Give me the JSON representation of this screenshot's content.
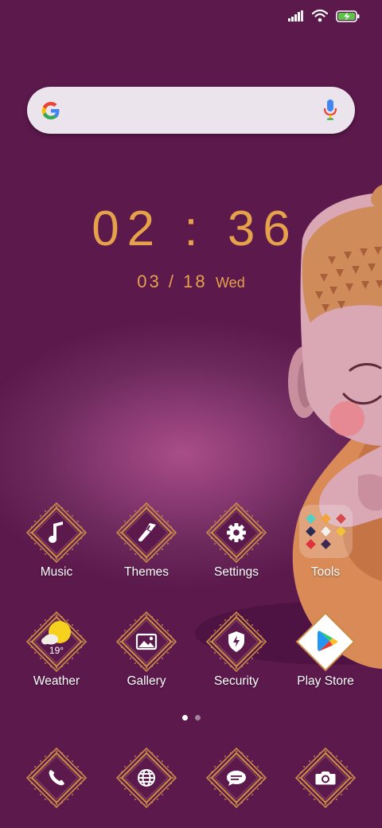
{
  "status_bar": {
    "signal_icon": "signal-bars-icon",
    "wifi_icon": "wifi-icon",
    "battery_icon": "battery-charging-icon"
  },
  "search": {
    "logo_icon": "google-logo-icon",
    "mic_icon": "mic-icon"
  },
  "clock": {
    "time": "02 : 36",
    "date": "03 / 18",
    "weekday": "Wed"
  },
  "home_apps": [
    {
      "label": "Music",
      "icon": "music-note-icon"
    },
    {
      "label": "Themes",
      "icon": "paintbrush-icon"
    },
    {
      "label": "Settings",
      "icon": "gear-icon"
    },
    {
      "label": "Tools",
      "icon": "folder-icon"
    },
    {
      "label": "Weather",
      "icon": "weather-icon",
      "temperature": "19°"
    },
    {
      "label": "Gallery",
      "icon": "image-icon"
    },
    {
      "label": "Security",
      "icon": "shield-icon"
    },
    {
      "label": "Play Store",
      "icon": "play-store-icon"
    }
  ],
  "dock": [
    {
      "name": "phone",
      "icon": "phone-icon"
    },
    {
      "name": "browser",
      "icon": "globe-icon"
    },
    {
      "name": "messages",
      "icon": "message-icon"
    },
    {
      "name": "camera",
      "icon": "camera-icon"
    }
  ],
  "page_indicator": {
    "pages": 2,
    "current": 1
  },
  "colors": {
    "background": "#5c194c",
    "accent_gold": "#e6a24a",
    "frame_gold": "#c98b46"
  }
}
